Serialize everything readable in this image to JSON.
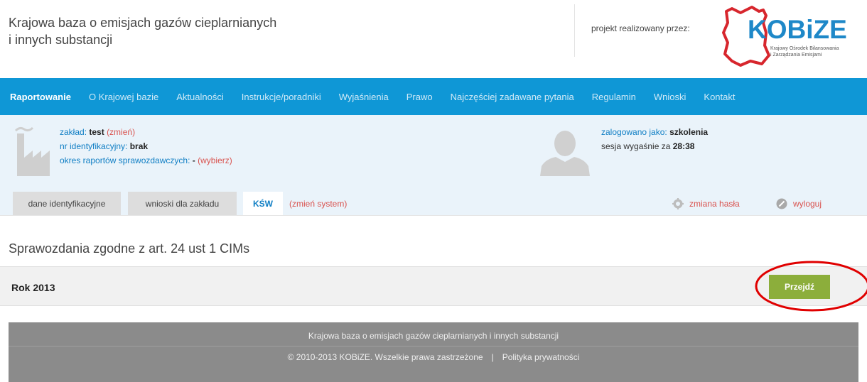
{
  "header": {
    "title_line1": "Krajowa baza o emisjach gazów cieplarnianych",
    "title_line2": "i innych substancji",
    "project_label": "projekt realizowany przez:",
    "logo_text": "KOBiZE",
    "logo_sub1": "Krajowy Ośrodek Bilansowania",
    "logo_sub2": "i Zarządzania Emisjami"
  },
  "nav": {
    "items": [
      {
        "label": "Raportowanie",
        "active": true
      },
      {
        "label": "O Krajowej bazie"
      },
      {
        "label": "Aktualności"
      },
      {
        "label": "Instrukcje/poradniki"
      },
      {
        "label": "Wyjaśnienia"
      },
      {
        "label": "Prawo"
      },
      {
        "label": "Najczęściej zadawane pytania"
      },
      {
        "label": "Regulamin"
      },
      {
        "label": "Wnioski"
      },
      {
        "label": "Kontakt"
      }
    ]
  },
  "info": {
    "facility_label": "zakład:",
    "facility_value": "test",
    "facility_change": "(zmień)",
    "id_label": "nr identyfikacyjny:",
    "id_value": "brak",
    "period_label": "okres raportów sprawozdawczych:",
    "period_value": "-",
    "period_choose": "(wybierz)",
    "logged_label": "zalogowano jako:",
    "logged_value": "szkolenia",
    "session_label": "sesja wygaśnie za",
    "session_value": "28:38"
  },
  "tabs": {
    "items": [
      "dane identyfikacyjne",
      "wnioski dla zakładu",
      "KŚW"
    ],
    "change_system": "(zmień system)",
    "change_password": "zmiana hasła",
    "logout": "wyloguj"
  },
  "main": {
    "section_title": "Sprawozdania zgodne z art. 24 ust 1 CIMs",
    "year_label": "Rok 2013",
    "go_button": "Przejdź"
  },
  "footer": {
    "line1": "Krajowa baza o emisjach gazów cieplarnianych i innych substancji",
    "copyright": "© 2010-2013 KOBiZE. Wszelkie prawa zastrzeżone",
    "separator": "|",
    "privacy": "Polityka prywatności"
  },
  "colors": {
    "nav_bg": "#0f97d6",
    "info_bg": "#eaf3fa",
    "link_red": "#d9534f",
    "button_green": "#8cae3b",
    "footer_bg": "#8b8b8b",
    "logo_blue": "#1e88c8",
    "logo_red": "#d7262d",
    "highlight_red": "#e00000"
  },
  "icons": [
    "kobize-logo",
    "factory-icon",
    "user-avatar-icon",
    "gear-icon",
    "logout-icon"
  ]
}
